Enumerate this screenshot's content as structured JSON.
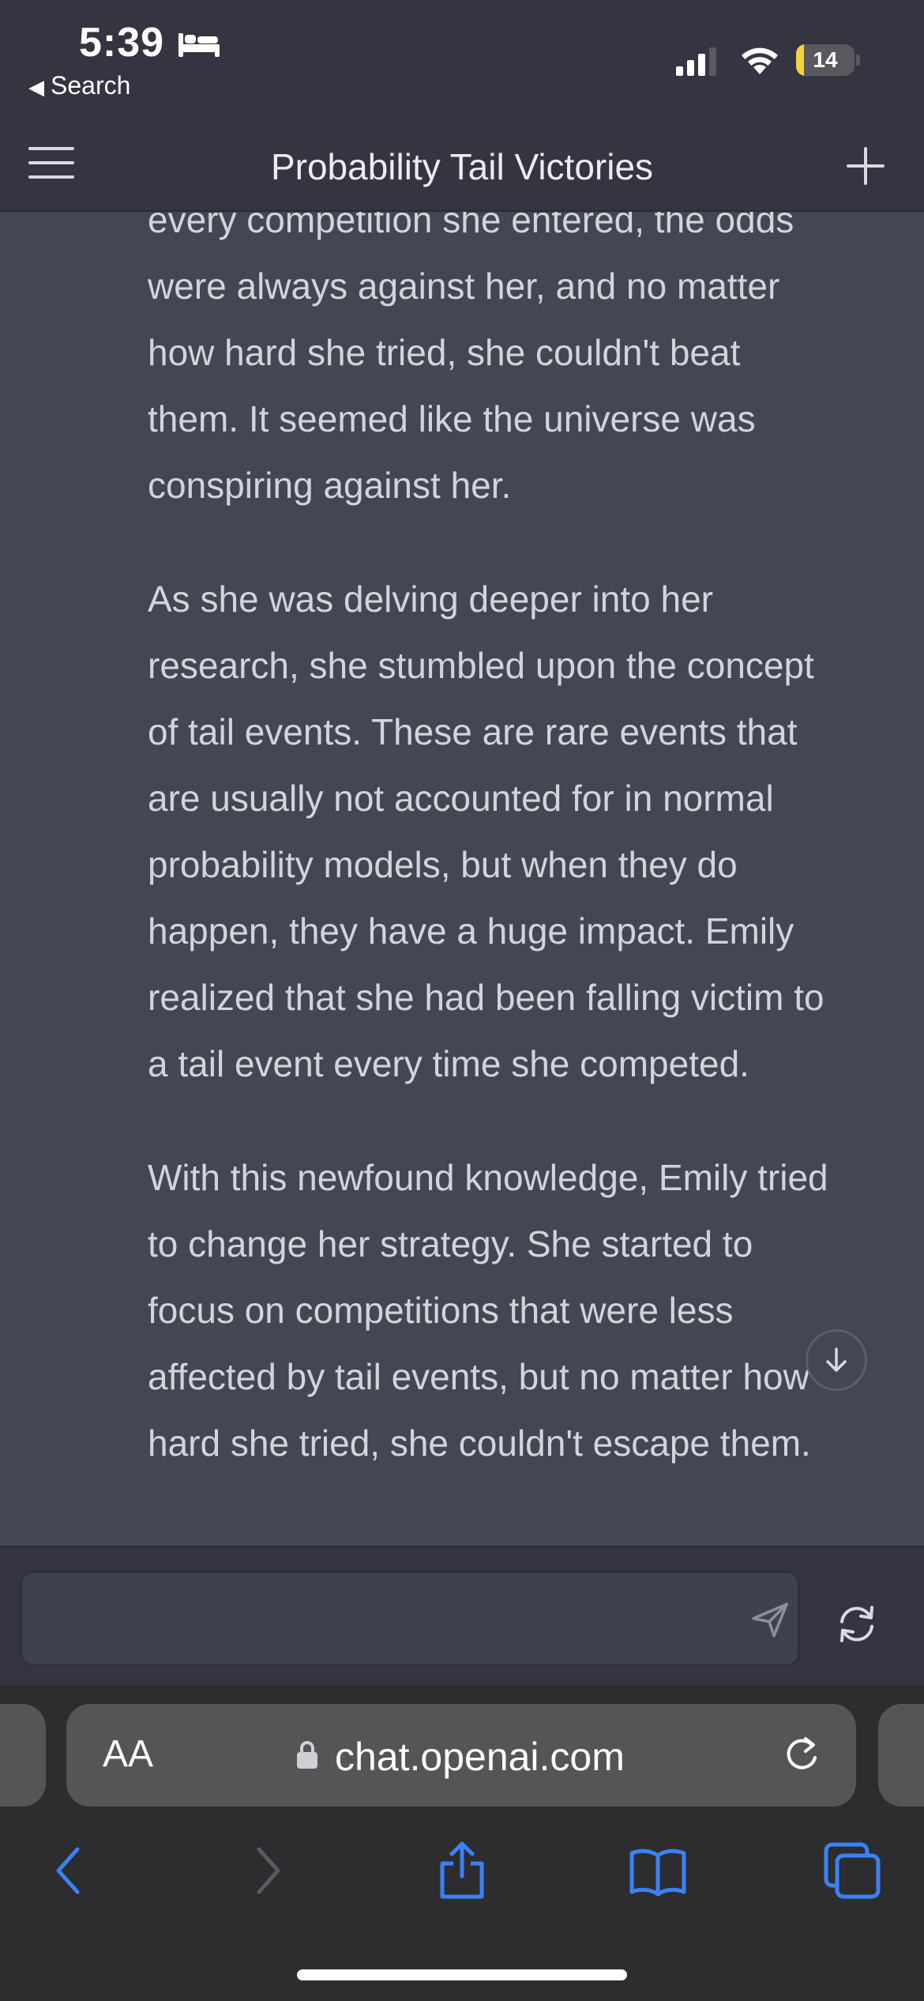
{
  "status_bar": {
    "time": "5:39",
    "back_app_label": "Search",
    "battery_percent": "14",
    "battery_level": 0.14
  },
  "header": {
    "title": "Probability Tail Victories"
  },
  "message": {
    "paragraphs": [
      {
        "lines": [
          "every competition she entered, the odds",
          "were always against her, and no matter",
          "how hard she tried, she couldn't beat",
          "them. It seemed like the universe was",
          "conspiring against her."
        ]
      },
      {
        "lines": [
          "As she was delving deeper into her",
          "research, she stumbled upon the concept",
          "of tail events. These are rare events that",
          "are usually not accounted for in normal",
          "probability models, but when they do",
          "happen, they have a huge impact. Emily",
          "realized that she had been falling victim to",
          "a tail event every time she competed."
        ]
      },
      {
        "lines": [
          "With this newfound knowledge, Emily tried",
          "to change her strategy. She started to",
          "focus on competitions that were less",
          "affected by tail events, but no matter how",
          "hard she tried, she couldn't escape them."
        ]
      }
    ]
  },
  "composer": {
    "placeholder": "",
    "value": ""
  },
  "browser": {
    "text_size_label": "AA",
    "url": "chat.openai.com"
  },
  "colors": {
    "background": "#444654",
    "header": "#343541",
    "accent_blue": "#3b82f6",
    "battery_low": "#f7d23c"
  }
}
